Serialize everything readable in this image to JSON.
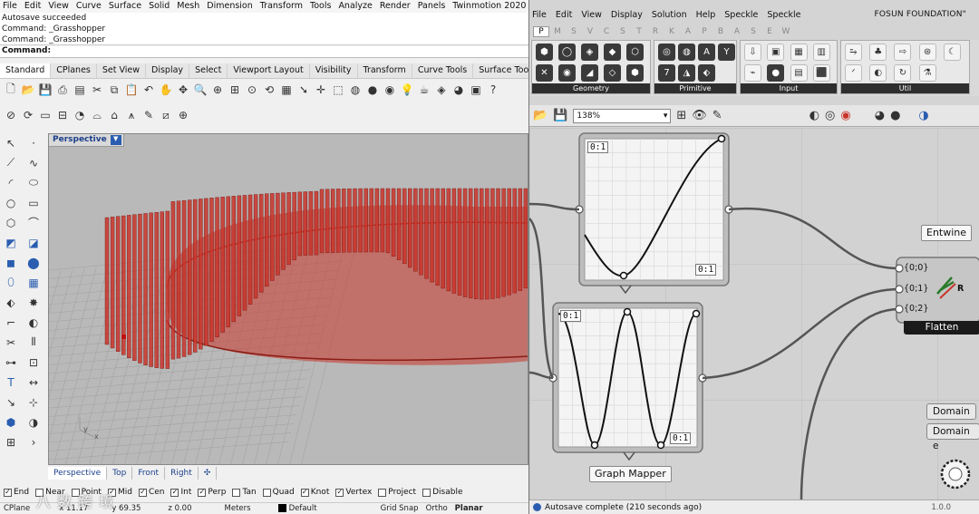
{
  "rhino": {
    "menu": [
      "File",
      "Edit",
      "View",
      "Curve",
      "Surface",
      "Solid",
      "Mesh",
      "Dimension",
      "Transform",
      "Tools",
      "Analyze",
      "Render",
      "Panels",
      "Twinmotion 2020",
      "V"
    ],
    "history": [
      "Autosave succeeded",
      "Command: _Grasshopper",
      "Command: _Grasshopper"
    ],
    "command_prompt": "Command:",
    "toolbar_tabs": [
      "Standard",
      "CPlanes",
      "Set View",
      "Display",
      "Select",
      "Viewport Layout",
      "Visibility",
      "Transform",
      "Curve Tools",
      "Surface Tools"
    ],
    "active_tab": "Standard",
    "viewport_title": "Perspective",
    "viewport_tabs": [
      "Perspective",
      "Top",
      "Front",
      "Right"
    ],
    "osnaps": [
      {
        "label": "End",
        "checked": true
      },
      {
        "label": "Near",
        "checked": false
      },
      {
        "label": "Point",
        "checked": false
      },
      {
        "label": "Mid",
        "checked": true
      },
      {
        "label": "Cen",
        "checked": true
      },
      {
        "label": "Int",
        "checked": true
      },
      {
        "label": "Perp",
        "checked": true
      },
      {
        "label": "Tan",
        "checked": false
      },
      {
        "label": "Quad",
        "checked": false
      },
      {
        "label": "Knot",
        "checked": true
      },
      {
        "label": "Vertex",
        "checked": true
      },
      {
        "label": "Project",
        "checked": false
      },
      {
        "label": "Disable",
        "checked": false
      }
    ],
    "status": {
      "cplane": "CPlane",
      "x": "x 11.17",
      "y": "y 69.35",
      "z": "z 0.00",
      "units": "Meters",
      "layer": "Default",
      "grid_snap": "Grid Snap",
      "ortho": "Ortho",
      "planar": "Planar"
    },
    "axis_labels": {
      "x": "x",
      "y": "y"
    },
    "watermark": "八 数 跨 境",
    "accent_color": "#2a5db0",
    "geometry_color": "#c8342a"
  },
  "grasshopper": {
    "menu": [
      "File",
      "Edit",
      "View",
      "Display",
      "Solution",
      "Help",
      "Speckle",
      "Speckle"
    ],
    "document_name": "FOSUN FOUNDATION\"",
    "category_tabs": [
      "P",
      "M",
      "S",
      "V",
      "C",
      "S",
      "T",
      "R",
      "K",
      "A",
      "P",
      "B",
      "A",
      "S",
      "E",
      "W"
    ],
    "ribbon_panels": [
      "Geometry",
      "Primitive",
      "Input",
      "Util"
    ],
    "zoom": "138%",
    "components": {
      "graph_mapper_label": "Graph Mapper",
      "graph_top_left": "0:1",
      "graph_bottom_right": "0:1",
      "entwine_label": "Entwine",
      "entwine_inputs": [
        "{0;0}",
        "{0;1}",
        "{0;2}"
      ],
      "entwine_output": "R",
      "flatten_label": "Flatten",
      "domain_1": "Domain",
      "domain_2": "Domain e"
    },
    "status_text": "Autosave complete (210 seconds ago)",
    "version": "1.0.0"
  }
}
